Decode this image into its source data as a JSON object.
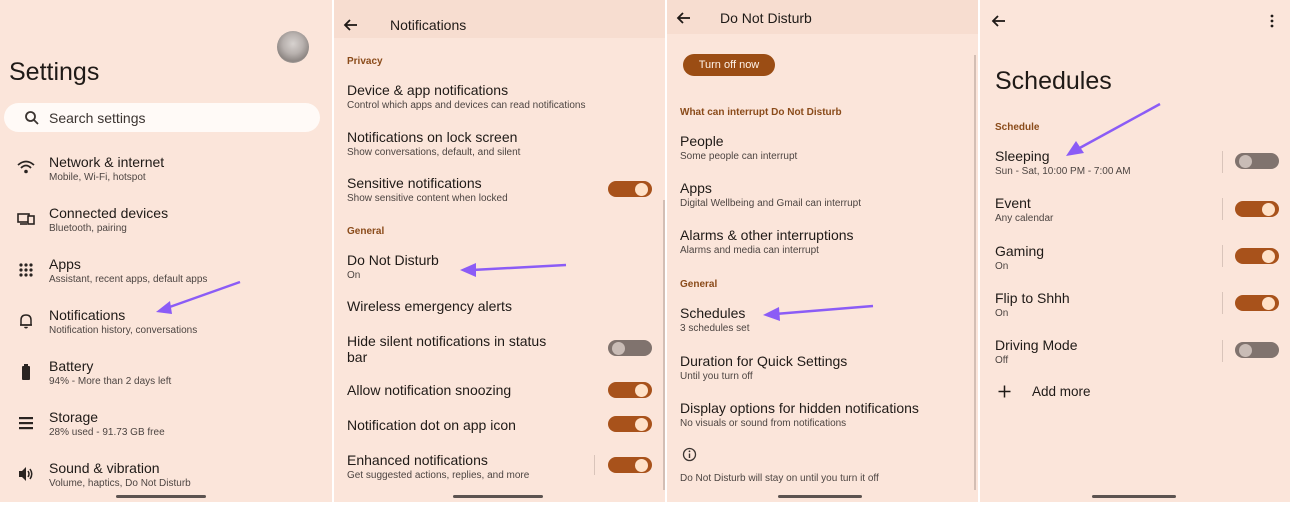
{
  "panels": {
    "settings": {
      "title": "Settings",
      "search_placeholder": "Search settings",
      "items": [
        {
          "title": "Network & internet",
          "subtitle": "Mobile, Wi-Fi, hotspot",
          "icon": "wifi-icon"
        },
        {
          "title": "Connected devices",
          "subtitle": "Bluetooth, pairing",
          "icon": "connected-devices-icon"
        },
        {
          "title": "Apps",
          "subtitle": "Assistant, recent apps, default apps",
          "icon": "apps-grid-icon"
        },
        {
          "title": "Notifications",
          "subtitle": "Notification history, conversations",
          "icon": "bell-icon"
        },
        {
          "title": "Battery",
          "subtitle": "94% - More than 2 days left",
          "icon": "battery-icon"
        },
        {
          "title": "Storage",
          "subtitle": "28% used - 91.73 GB free",
          "icon": "storage-icon"
        },
        {
          "title": "Sound & vibration",
          "subtitle": "Volume, haptics, Do Not Disturb",
          "icon": "speaker-icon"
        }
      ]
    },
    "notifications": {
      "title": "Notifications",
      "sections": {
        "privacy": "Privacy",
        "general": "General"
      },
      "items": [
        {
          "title": "Device & app notifications",
          "subtitle": "Control which apps and devices can read notifications"
        },
        {
          "title": "Notifications on lock screen",
          "subtitle": "Show conversations, default, and silent"
        },
        {
          "title": "Sensitive notifications",
          "subtitle": "Show sensitive content when locked",
          "toggle": "on"
        },
        {
          "title": "Do Not Disturb",
          "subtitle": "On"
        },
        {
          "title": "Wireless emergency alerts",
          "subtitle": ""
        },
        {
          "title": "Hide silent notifications in status",
          "title2": "bar",
          "toggle": "off"
        },
        {
          "title": "Allow notification snoozing",
          "toggle": "on"
        },
        {
          "title": "Notification dot on app icon",
          "toggle": "on"
        },
        {
          "title": "Enhanced notifications",
          "subtitle": "Get suggested actions, replies, and more",
          "toggle": "on"
        }
      ]
    },
    "dnd": {
      "title": "Do Not Disturb",
      "turn_off_button": "Turn off now",
      "sections": {
        "interrupt": "What can interrupt Do Not Disturb",
        "general": "General"
      },
      "items": [
        {
          "title": "People",
          "subtitle": "Some people can interrupt"
        },
        {
          "title": "Apps",
          "subtitle": "Digital Wellbeing and Gmail can interrupt"
        },
        {
          "title": "Alarms & other interruptions",
          "subtitle": "Alarms and media can interrupt"
        },
        {
          "title": "Schedules",
          "subtitle": "3 schedules set"
        },
        {
          "title": "Duration for Quick Settings",
          "subtitle": "Until you turn off"
        },
        {
          "title": "Display options for hidden notifications",
          "subtitle": "No visuals or sound from notifications"
        }
      ],
      "footer": "Do Not Disturb will stay on until you turn it off"
    },
    "schedules": {
      "title": "Schedules",
      "section": "Schedule",
      "items": [
        {
          "title": "Sleeping",
          "subtitle": "Sun - Sat, 10:00 PM - 7:00 AM",
          "toggle": "off"
        },
        {
          "title": "Event",
          "subtitle": "Any calendar",
          "toggle": "on"
        },
        {
          "title": "Gaming",
          "subtitle": "On",
          "toggle": "on"
        },
        {
          "title": "Flip to Shhh",
          "subtitle": "On",
          "toggle": "on"
        },
        {
          "title": "Driving Mode",
          "subtitle": "Off",
          "toggle": "off"
        }
      ],
      "add_more": "Add more"
    }
  },
  "colors": {
    "panel_bg": "#fbe5da",
    "accent": "#a8521b",
    "section_label": "#8a4b1a",
    "annotation_arrow": "#8b5cf6"
  }
}
